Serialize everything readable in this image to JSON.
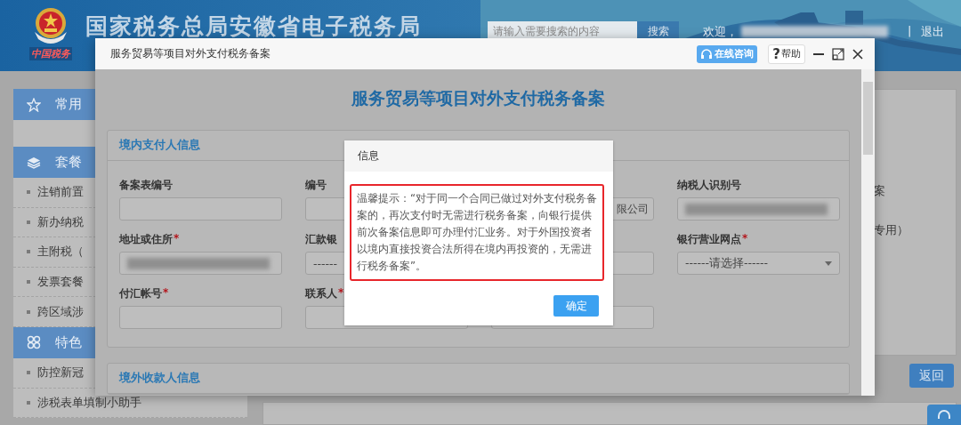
{
  "header": {
    "logo_caption": "中国税务",
    "site_title": "国家税务总局安徽省电子税务局",
    "search": {
      "placeholder": "请输入需要搜索的内容",
      "button": "搜索"
    },
    "welcome": "欢迎，",
    "user_blurred": true,
    "separator": "|",
    "logout": "退出"
  },
  "sidebar": {
    "sections": [
      {
        "title": "常用",
        "kind": "star"
      },
      {
        "title": "套餐",
        "kind": "layers",
        "items": [
          "注销前置",
          "新办纳税",
          "主附税（",
          "发票套餐",
          "跨区域涉"
        ]
      },
      {
        "title": "特色",
        "kind": "clover",
        "items": [
          "防控新冠",
          "涉税表单填制小助手"
        ]
      }
    ]
  },
  "background_panel": {
    "texts": [
      "案",
      "专用）"
    ],
    "back_button": "返回"
  },
  "form_window": {
    "title": "服务贸易等项目对外支付税务备案",
    "consult_button": "在线咨询",
    "help_button": {
      "mark": "?",
      "label": "帮助"
    },
    "heading": "服务贸易等项目对外支付税务备案",
    "sections": [
      {
        "title": "境内支付人信息",
        "fields": [
          {
            "label": "备案表编号",
            "kind": "input"
          },
          {
            "label": "编号",
            "kind": "input"
          },
          {
            "kind": "input",
            "value": "限公司"
          },
          {
            "label": "纳税人识别号",
            "kind": "input",
            "blurred": true
          },
          {
            "label": "地址或住所",
            "required_mark": "*",
            "kind": "input",
            "blurred": true
          },
          {
            "label": "汇款银",
            "kind": "select",
            "value": "------"
          },
          {
            "kind": "input"
          },
          {
            "label": "银行营业网点",
            "required_mark": "*",
            "kind": "select",
            "value": "------请选择------"
          },
          {
            "label": "付汇帐号",
            "required_mark": "*",
            "kind": "input"
          },
          {
            "label": "联系人",
            "required_mark": "*",
            "kind": "input"
          },
          {
            "kind": "input"
          }
        ]
      },
      {
        "title": "境外收款人信息"
      }
    ]
  },
  "dialog": {
    "title": "信息",
    "message": "温馨提示：“对于同一个合同已做过对外支付税务备案的，再次支付时无需进行税务备案，向银行提供前次备案信息即可办理付汇业务。对于外国投资者以境内直接投资合法所得在境内再投资的，无需进行税务备案”。",
    "confirm_button": "确定"
  }
}
